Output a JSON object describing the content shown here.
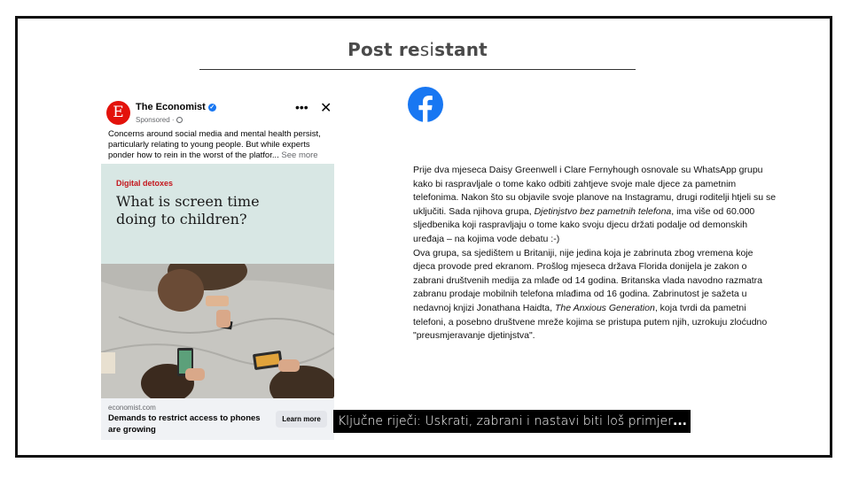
{
  "slide": {
    "title_part1": "Post re",
    "title_part2": "si",
    "title_part3": "stant"
  },
  "ad": {
    "logo_letter": "E",
    "brand": "The Economist",
    "sponsored": "Sponsored ·",
    "more_icon": "more-options-icon",
    "close_icon": "close-icon",
    "text": "Concerns around social media and mental health persist, particularly relating to young people. But while experts ponder how to rein in the worst of the platfor...",
    "see_more": "See more",
    "image_tag": "Digital detoxes",
    "image_headline": "What is screen time doing to children?",
    "domain": "economist.com",
    "cta_title": "Demands to restrict access to phones are growing",
    "cta_button": "Learn more"
  },
  "facebook_icon": "facebook-logo-icon",
  "body": {
    "p1_a": "Prije dva mjeseca Daisy Greenwell i Clare Fernyhough osnovale su WhatsApp grupu kako bi raspravljale o tome kako odbiti zahtjeve svoje male djece za pametnim telefonima. Nakon što su objavile svoje planove na Instagramu, drugi roditelji htjeli su se uključiti. Sada njihova grupa, ",
    "p1_italic": "Djetinjstvo bez pametnih telefona",
    "p1_b": ", ima više od 60.000 sljedbenika koji raspravljaju o tome kako svoju djecu držati podalje od demonskih uređaja – na kojima vode debatu :-)",
    "p2_a": "Ova grupa, sa sjedištem u Britaniji, nije jedina koja je zabrinuta zbog vremena koje djeca provode pred ekranom. Prošlog mjeseca država Florida donijela je zakon o zabrani društvenih medija za mlađe od 14 godina. Britanska vlada navodno razmatra zabranu prodaje mobilnih telefona mlađima od 16 godina. Zabrinutost je sažeta u nedavnoj knjizi Jonathana Haidta, ",
    "p2_italic": "The Anxious Generation",
    "p2_b": ", koja tvrdi da pametni telefoni, a posebno društvene mreže kojima se pristupa putem njih, uzrokuju zloćudno \"preusmjeravanje djetinjstva\"."
  },
  "caption": {
    "text": "Ključne riječi: Uskrati, zabrani i nastavi biti loš primjer",
    "ellipsis": "..."
  },
  "colors": {
    "economist_red": "#e3120b",
    "facebook_blue": "#1877f2",
    "tag_red": "#c4161c"
  }
}
